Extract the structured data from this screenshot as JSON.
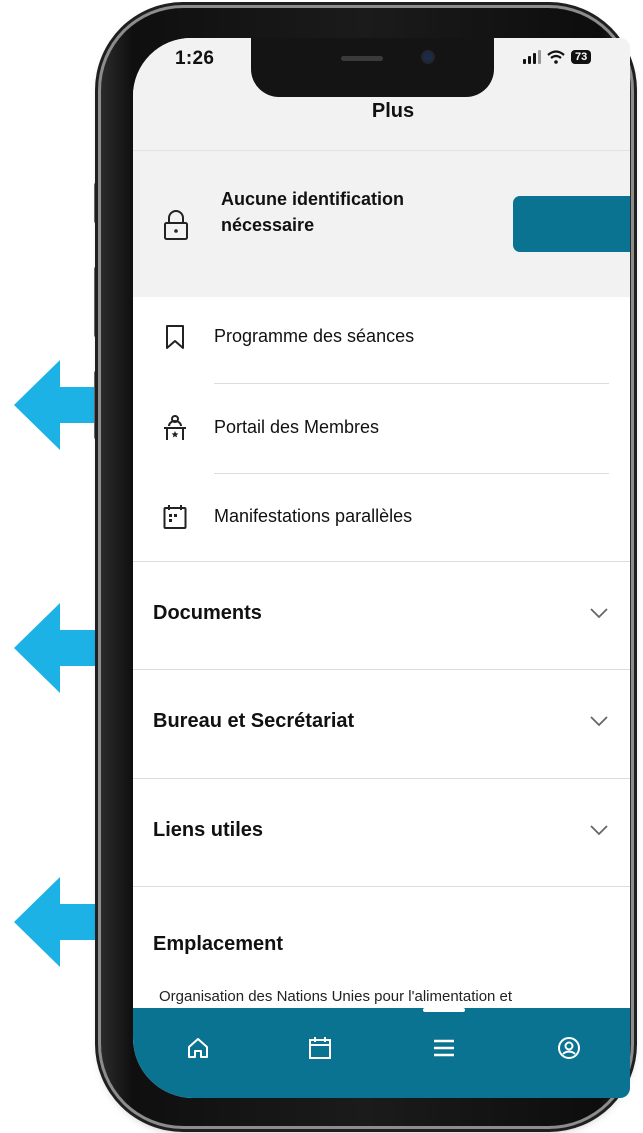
{
  "status": {
    "time": "1:26",
    "battery": "73"
  },
  "page_title": "Plus",
  "identification": {
    "text": "Aucune identification nécessaire",
    "button_label": ""
  },
  "menu_items": [
    {
      "label": "Programme des séances",
      "icon": "bookmark-icon"
    },
    {
      "label": "Portail des Membres",
      "icon": "member-desk-icon"
    },
    {
      "label": "Manifestations parallèles",
      "icon": "calendar-event-icon"
    }
  ],
  "accordions": [
    {
      "label": "Documents",
      "icon": "chevron-down-icon"
    },
    {
      "label": "Bureau et Secrétariat",
      "icon": "chevron-down-icon"
    },
    {
      "label": "Liens utiles",
      "icon": "chevron-down-icon"
    }
  ],
  "location": {
    "title": "Emplacement",
    "text": "Organisation des Nations Unies pour l'alimentation et"
  },
  "tabs": [
    {
      "name": "home-icon"
    },
    {
      "name": "calendar-icon"
    },
    {
      "name": "menu-icon",
      "active": true
    },
    {
      "name": "profile-icon"
    }
  ],
  "colors": {
    "accent": "#0b7392",
    "arrow": "#1cb2e6",
    "background": "#f2f2f2"
  }
}
